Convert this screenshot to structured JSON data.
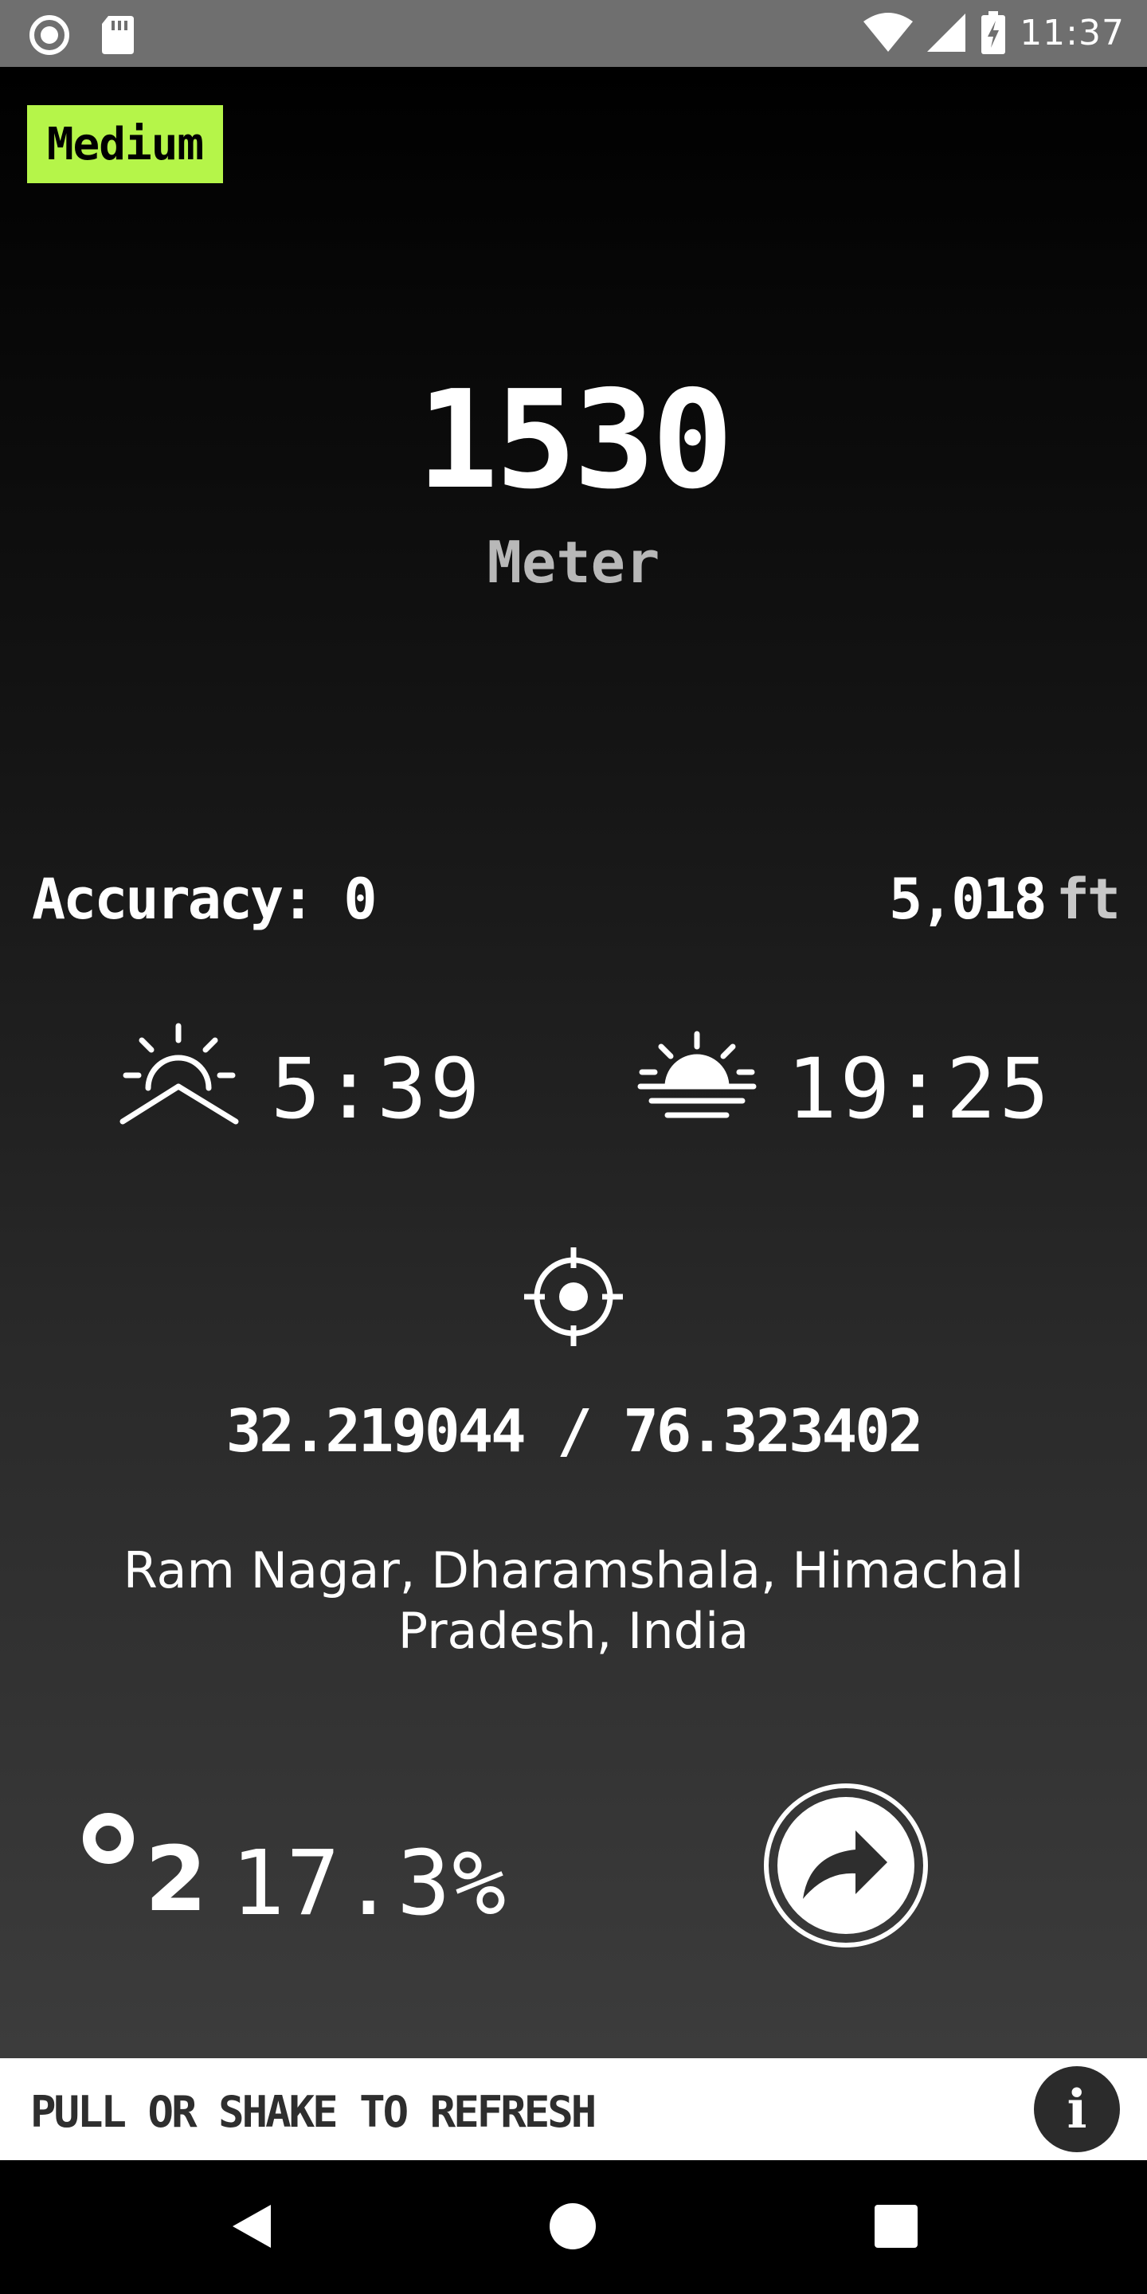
{
  "status_bar": {
    "time": "11:37",
    "icons": [
      "record-icon",
      "sd-card-icon",
      "wifi-icon",
      "signal-icon",
      "battery-charging-icon"
    ]
  },
  "badge": {
    "label": "Medium",
    "color": "#b5f549"
  },
  "altitude": {
    "value": "1530",
    "unit": "Meter"
  },
  "accuracy": {
    "label": "Accuracy: 0"
  },
  "feet": {
    "value": "5,018",
    "unit": "ft"
  },
  "sun": {
    "sunrise_icon": "sunrise-icon",
    "sunrise": "5:39",
    "sunset_icon": "sunset-icon",
    "sunset": "19:25"
  },
  "location": {
    "gps_icon": "gps-target-icon",
    "coordinates": "32.219044 / 76.323402",
    "address": "Ram Nagar, Dharamshala, Himachal Pradesh, India"
  },
  "oxygen": {
    "symbol_o": "O",
    "symbol_sub": "2",
    "value": "17.3%"
  },
  "share": {
    "icon": "share-icon"
  },
  "refresh_bar": {
    "text": "PULL OR SHAKE TO REFRESH",
    "info_label": "i"
  },
  "nav": {
    "back": "back-icon",
    "home": "home-icon",
    "recents": "recents-icon"
  }
}
